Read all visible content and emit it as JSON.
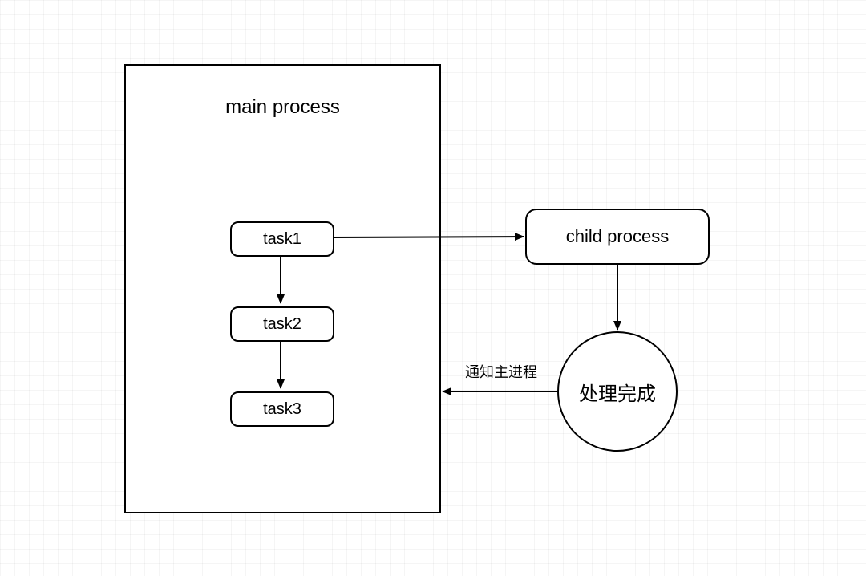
{
  "main_process": {
    "title": "main process",
    "tasks": [
      "task1",
      "task2",
      "task3"
    ]
  },
  "child_process": {
    "label": "child process"
  },
  "done_node": {
    "label": "处理完成"
  },
  "edges": {
    "notify_label": "通知主进程"
  }
}
